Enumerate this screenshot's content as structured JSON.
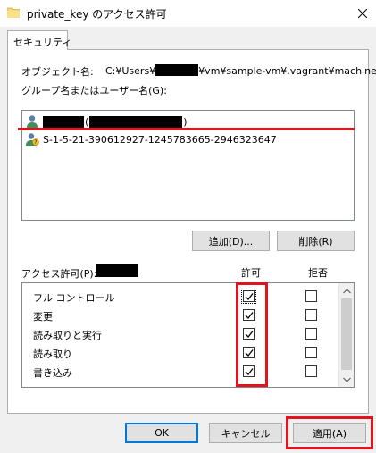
{
  "window": {
    "title": "private_key のアクセス許可"
  },
  "tabs": [
    {
      "label": "セキュリティ"
    }
  ],
  "object": {
    "label": "オブジェクト名:",
    "path_prefix": "C:¥Users¥",
    "path_suffix": "¥vm¥sample-vm¥.vagrant¥machine"
  },
  "groups": {
    "label": "グループ名またはユーザー名(G):",
    "users": [
      {
        "name": "",
        "redacted": true,
        "icon": "user-icon"
      },
      {
        "name": "S-1-5-21-390612927-1245783665-2946323647",
        "icon": "unknown-user-icon"
      }
    ],
    "add_label": "追加(D)...",
    "remove_label": "削除(R)"
  },
  "permissions": {
    "label": "アクセス許可(P):",
    "allow_header": "許可",
    "deny_header": "拒否",
    "rows": [
      {
        "label": "フル コントロール",
        "allow": true,
        "deny": false
      },
      {
        "label": "変更",
        "allow": true,
        "deny": false
      },
      {
        "label": "読み取りと実行",
        "allow": true,
        "deny": false
      },
      {
        "label": "読み取り",
        "allow": true,
        "deny": false
      },
      {
        "label": "書き込み",
        "allow": true,
        "deny": false
      }
    ]
  },
  "footer": {
    "ok_label": "OK",
    "cancel_label": "キャンセル",
    "apply_label": "適用(A)"
  },
  "colors": {
    "highlight": "#e0141c",
    "focus": "#0078d7"
  }
}
